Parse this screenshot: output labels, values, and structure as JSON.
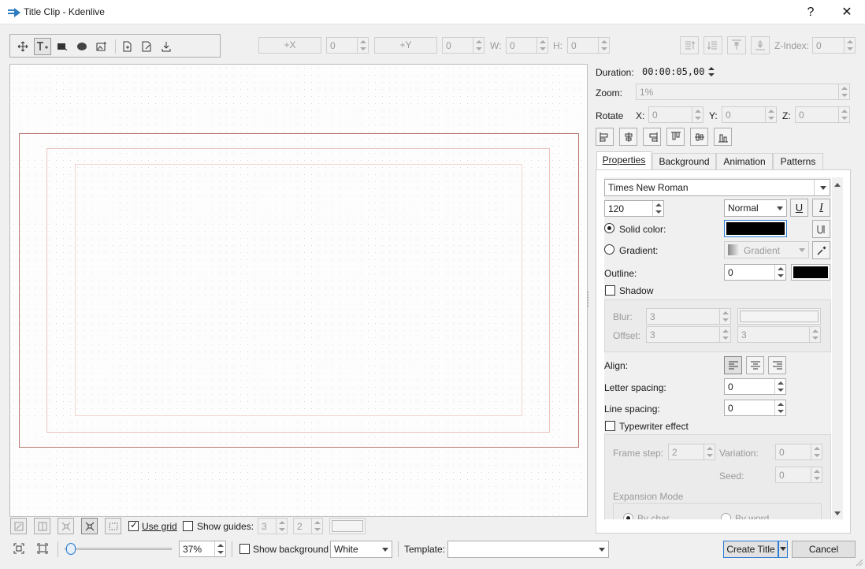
{
  "window": {
    "title": "Title Clip - Kdenlive",
    "help": "?",
    "close": "✕"
  },
  "toolbar": {
    "x_button": "+X",
    "x_value": "0",
    "y_button": "+Y",
    "y_value": "0",
    "w_label": "W:",
    "w_value": "0",
    "h_label": "H:",
    "h_value": "0",
    "z_label": "Z-Index:",
    "z_value": "0"
  },
  "side": {
    "duration_label": "Duration:",
    "duration_value": "00:00:05,00",
    "zoom_label": "Zoom:",
    "zoom_value": "1%",
    "rotate_label": "Rotate",
    "rx_label": "X:",
    "rx_value": "0",
    "ry_label": "Y:",
    "ry_value": "0",
    "rz_label": "Z:",
    "rz_value": "0"
  },
  "tabs": [
    "Properties",
    "Background",
    "Animation",
    "Patterns"
  ],
  "props": {
    "font": "Times New Roman",
    "size": "120",
    "weight": "Normal",
    "underline": "U",
    "italic": "I",
    "solid_label": "Solid color:",
    "gradient_label": "Gradient:",
    "gradient_value": "Gradient",
    "outline_label": "Outline:",
    "outline_value": "0",
    "shadow_label": "Shadow",
    "blur_label": "Blur:",
    "blur_value": "3",
    "offset_label": "Offset:",
    "offset_x": "3",
    "offset_y": "3",
    "align_label": "Align:",
    "letter_label": "Letter spacing:",
    "letter_value": "0",
    "line_label": "Line spacing:",
    "line_value": "0",
    "typewriter_label": "Typewriter effect",
    "frame_step_label": "Frame step:",
    "frame_step_value": "2",
    "variation_label": "Variation:",
    "variation_value": "0",
    "seed_label": "Seed:",
    "seed_value": "0",
    "expansion_label": "Expansion Mode",
    "by_char": "By char",
    "by_word": "By word"
  },
  "bottom": {
    "use_grid": "Use grid",
    "show_guides": "Show guides:",
    "guides_a": "3",
    "guides_b": "2",
    "zoom_value": "37%",
    "show_background": "Show background",
    "bg_color": "White",
    "template_label": "Template:",
    "template_value": "",
    "create": "Create Title",
    "cancel": "Cancel"
  }
}
